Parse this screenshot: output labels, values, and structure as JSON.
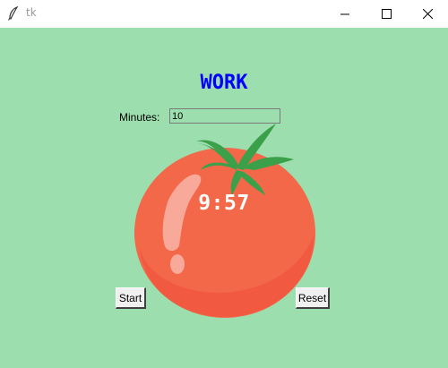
{
  "window": {
    "title": "tk",
    "icons": {
      "app": "feather-icon",
      "minimize": "minimize-icon",
      "maximize": "maximize-icon",
      "close": "close-icon"
    }
  },
  "main": {
    "mode_title": "WORK",
    "mode_title_color": "#0000ff",
    "minutes_label": "Minutes:",
    "minutes_value": "10",
    "timer_display": "9:57",
    "start_label": "Start",
    "reset_label": "Reset"
  },
  "colors": {
    "background": "#9ddeae",
    "tomato": "#f26849",
    "leaves": "#3aa04a"
  }
}
